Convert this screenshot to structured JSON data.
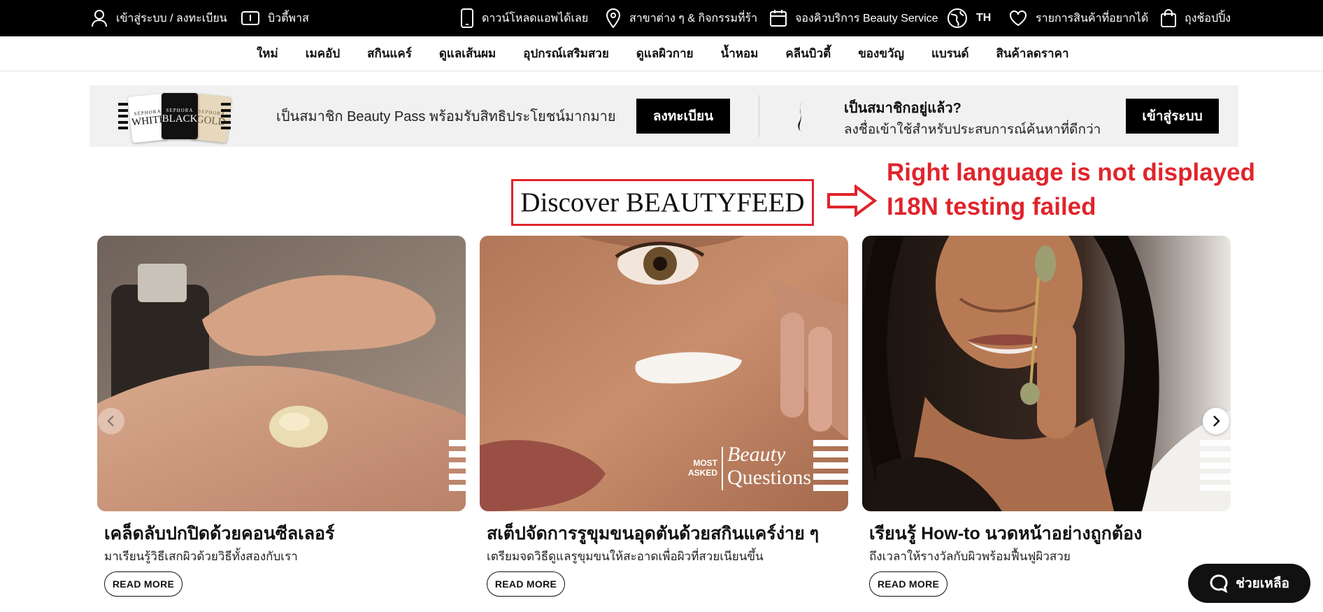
{
  "topbar": {
    "login": "เข้าสู่ระบบ / ลงทะเบียน",
    "beauty_pass": "บิวตี้พาส",
    "download_app": "ดาวน์โหลดแอพได้เลย",
    "stores": "สาขาต่าง ๆ & กิจกรรมที่ร้า",
    "booking": "จองคิวบริการ Beauty Service",
    "language": "TH",
    "wishlist": "รายการสินค้าที่อยากได้",
    "bag": "ถุงช้อปปิ้ง",
    "icons": [
      "user-icon",
      "pass-card-icon",
      "mobile-phone-icon",
      "location-pin-icon",
      "calendar-icon",
      "globe-icon",
      "heart-icon",
      "shopping-bag-icon"
    ]
  },
  "nav": {
    "items": [
      "ใหม่",
      "เมคอัป",
      "สกินแคร์",
      "ดูแลเส้นผม",
      "อุปกรณ์เสริมสวย",
      "ดูแลผิวกาย",
      "น้ำหอม",
      "คลีนบิวตี้",
      "ของขวัญ",
      "แบรนด์",
      "สินค้าลดราคา"
    ]
  },
  "banner": {
    "cards": [
      {
        "brand": "SEPHORA",
        "tier": "WHITE",
        "color": "#ffffff"
      },
      {
        "brand": "SEPHORA",
        "tier": "BLACK",
        "color": "#111111"
      },
      {
        "brand": "SEPHORA",
        "tier": "GOLD",
        "color": "#e6d7bd"
      }
    ],
    "promo_text": "เป็นสมาชิก Beauty Pass พร้อมรับสิทธิประโยชน์มากมาย",
    "register_button": "ลงทะเบียน",
    "member_title": "เป็นสมาชิกอยู่แล้ว?",
    "member_subtitle": "ลงชื่อเข้าใช้สำหรับประสบการณ์ค้นหาที่ดีกว่า",
    "login_button": "เข้าสู่ระบบ"
  },
  "section": {
    "title": "Discover BEAUTYFEED"
  },
  "annotation": {
    "line1": "Right language is not displayed",
    "line2": "I18N testing failed",
    "color": "#e0242b"
  },
  "articles": [
    {
      "title": "เคล็ดลับปกปิดด้วยคอนซีลเลอร์",
      "subtitle": "มาเรียนรู้วิธีเสกผิวด้วยวิธีทั้งสองกับเรา",
      "button": "READ MORE"
    },
    {
      "title": "สเต็ปจัดการรูขุมขนอุดตันด้วยสกินแคร์ง่าย ๆ",
      "subtitle": "เตรียมจดวิธีดูแลรูขุมขนให้สะอาดเพื่อผิวที่สวยเนียนขึ้น",
      "button": "READ MORE",
      "overlay_small_1": "MOST",
      "overlay_small_2": "ASKED",
      "overlay_big_1": "Beauty",
      "overlay_big_2": "Questions"
    },
    {
      "title": "เรียนรู้ How-to นวดหน้าอย่างถูกต้อง",
      "subtitle": "ถึงเวลาให้รางวัลกับผิวพร้อมฟื้นฟูผิวสวย",
      "button": "READ MORE"
    }
  ],
  "help_button": "ช่วยเหลือ"
}
